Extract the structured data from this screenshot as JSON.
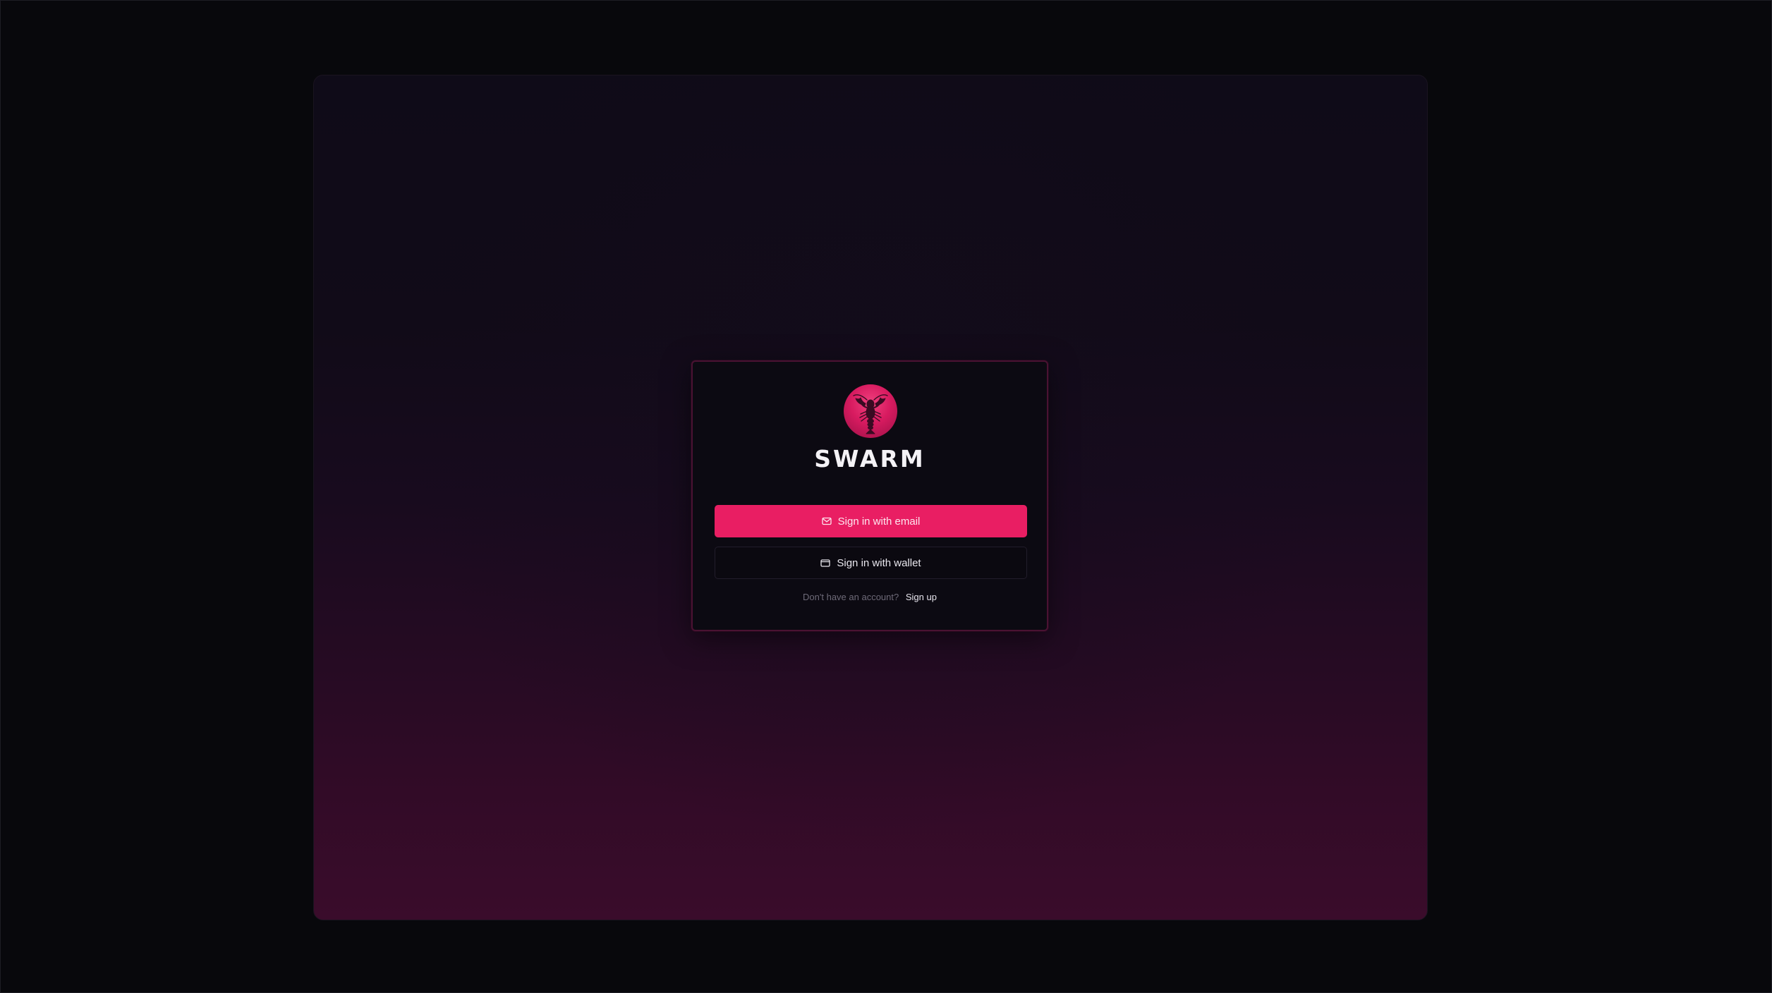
{
  "brand": {
    "name": "SWARM",
    "logo_icon": "lobster-icon",
    "accent": "#e91e63"
  },
  "auth": {
    "email_button": {
      "label": "Sign in with email",
      "icon": "mail-icon"
    },
    "wallet_button": {
      "label": "Sign in with wallet",
      "icon": "wallet-icon"
    },
    "signup_prompt": "Don't have an account?",
    "signup_link": "Sign up"
  }
}
